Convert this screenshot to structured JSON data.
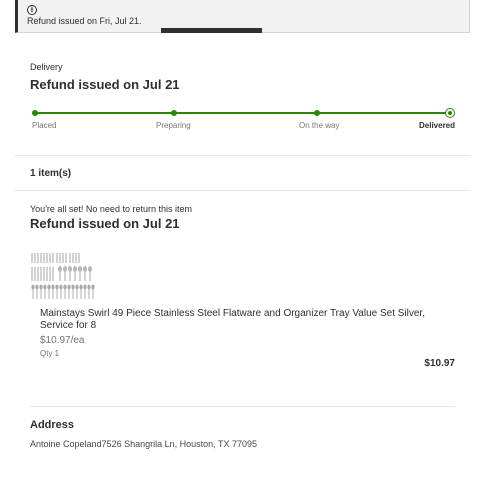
{
  "banner": {
    "message": "Refund issued on Fri, Jul 21."
  },
  "delivery": {
    "section_label": "Delivery",
    "title": "Refund issued on Jul 21",
    "steps": [
      {
        "label": "Placed"
      },
      {
        "label": "Preparing"
      },
      {
        "label": "On the way"
      },
      {
        "label": "Delivered"
      }
    ]
  },
  "items_header": {
    "count_label": "1 item(s)"
  },
  "item_group": {
    "note": "You're all set! No need to return this item",
    "title": "Refund issued on Jul 21"
  },
  "product": {
    "name": "Mainstays Swirl 49 Piece Stainless Steel Flatware and Organizer Tray Value Set Silver, Service for 8",
    "unit_price": "$10.97/ea",
    "quantity": "Qty 1",
    "total": "$10.97"
  },
  "address": {
    "title": "Address",
    "text": "Antoine Copeland7526 Shangrila Ln, Houston, TX 77095"
  },
  "colors": {
    "accent_green": "#2a8703",
    "text": "#2e2f32",
    "muted": "#74767c"
  },
  "icons": {
    "banner": "info-icon"
  }
}
